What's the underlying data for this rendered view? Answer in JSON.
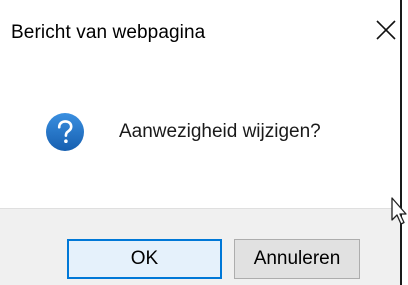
{
  "dialog": {
    "title": "Bericht van webpagina",
    "message": "Aanwezigheid wijzigen?",
    "ok_label": "OK",
    "cancel_label": "Annuleren"
  },
  "icons": {
    "close": "close-icon",
    "message": "question-icon",
    "cursor": "mouse-cursor-icon"
  },
  "colors": {
    "question_icon_blue": "#1c74c9",
    "default_button_border": "#0078d7",
    "button_area_bg": "#f0f0f0"
  }
}
